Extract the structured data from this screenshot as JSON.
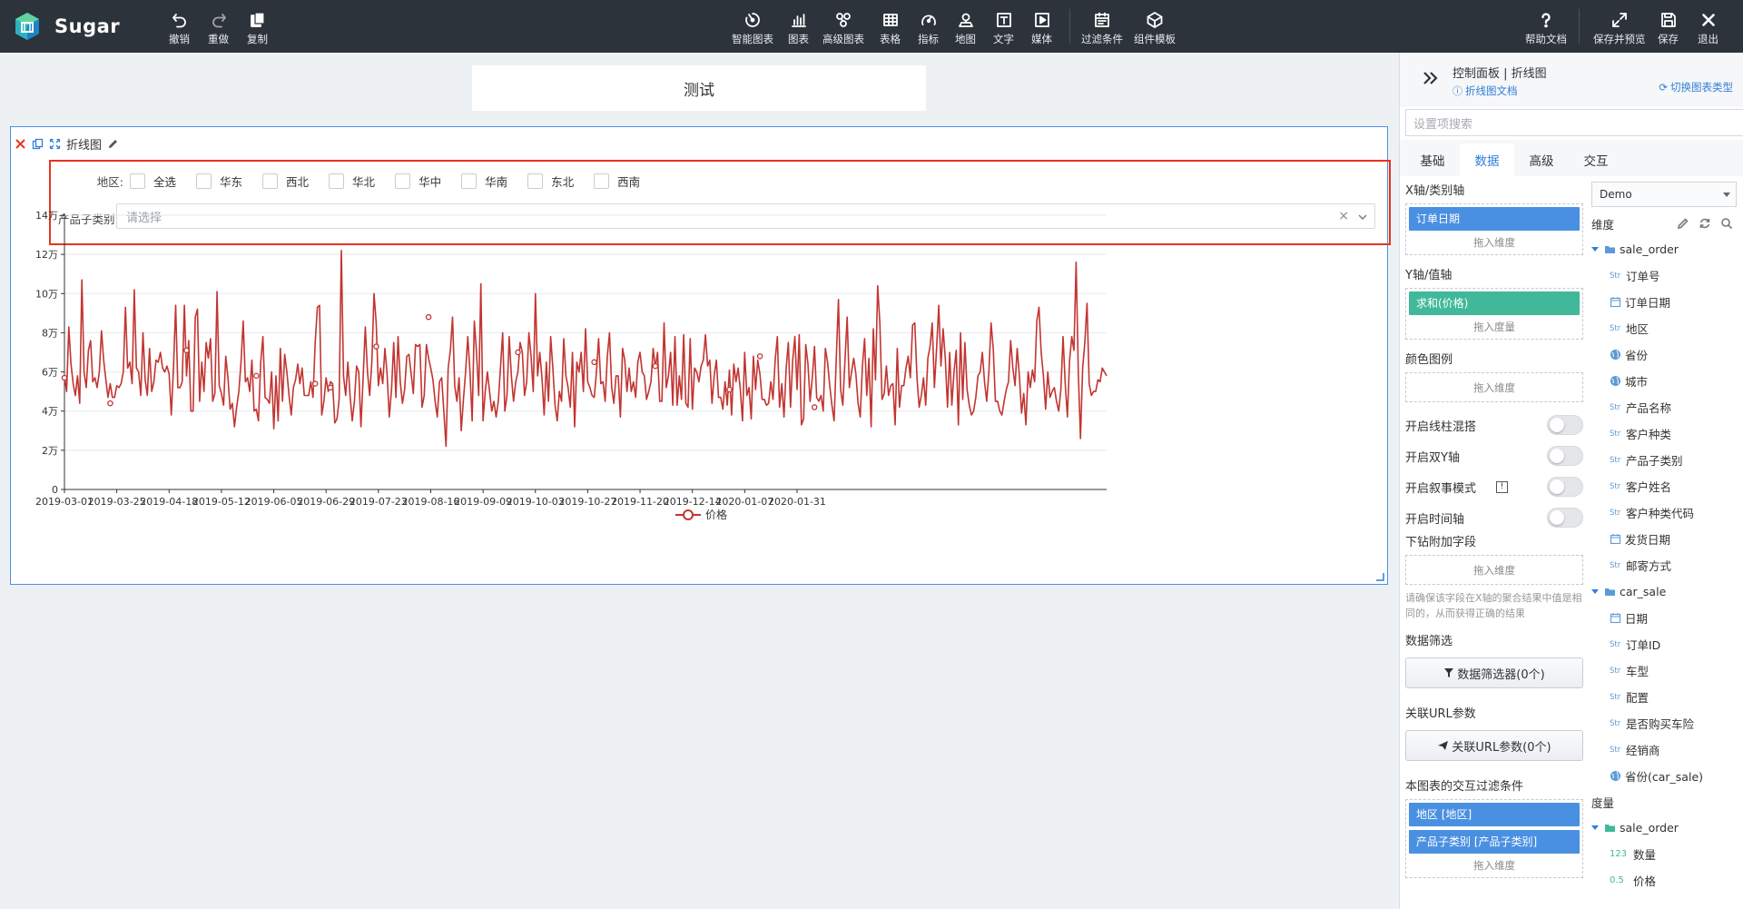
{
  "app": {
    "name": "Sugar"
  },
  "toolbar": {
    "left": [
      {
        "id": "undo",
        "label": "撤销",
        "icon": "undo-icon"
      },
      {
        "id": "redo",
        "label": "重做",
        "icon": "redo-icon"
      },
      {
        "id": "copy",
        "label": "复制",
        "icon": "copy-icon"
      }
    ],
    "center": [
      {
        "id": "smart",
        "label": "智能图表",
        "icon": "smart-chart-icon"
      },
      {
        "id": "chart",
        "label": "图表",
        "icon": "bar-chart-icon"
      },
      {
        "id": "adv",
        "label": "高级图表",
        "icon": "advanced-chart-icon"
      },
      {
        "id": "table",
        "label": "表格",
        "icon": "table-icon"
      },
      {
        "id": "metric",
        "label": "指标",
        "icon": "gauge-icon"
      },
      {
        "id": "map",
        "label": "地图",
        "icon": "map-pin-icon"
      },
      {
        "id": "text",
        "label": "文字",
        "icon": "text-icon"
      },
      {
        "id": "media",
        "label": "媒体",
        "icon": "media-icon"
      },
      {
        "id": "filter",
        "label": "过滤条件",
        "icon": "filter-calendar-icon"
      },
      {
        "id": "template",
        "label": "组件模板",
        "icon": "template-icon"
      }
    ],
    "right": [
      {
        "id": "help",
        "label": "帮助文档",
        "icon": "help-icon"
      },
      {
        "id": "preview",
        "label": "保存并预览",
        "icon": "expand-icon"
      },
      {
        "id": "save",
        "label": "保存",
        "icon": "save-icon"
      },
      {
        "id": "exit",
        "label": "退出",
        "icon": "close-icon"
      }
    ]
  },
  "page": {
    "title": "测试"
  },
  "widget": {
    "title": "折线图",
    "filters": {
      "region_label": "地区:",
      "regions": [
        "全选",
        "华东",
        "西北",
        "华北",
        "华中",
        "华南",
        "东北",
        "西南"
      ],
      "subcat_label": "产品子类别:",
      "subcat_placeholder": "请选择"
    }
  },
  "chart_data": {
    "type": "line",
    "x_start": "2019-03-01",
    "x_tick_labels": [
      "2019-03-01",
      "2019-03-25",
      "2019-04-18",
      "2019-05-12",
      "2019-06-05",
      "2019-06-29",
      "2019-07-23",
      "2019-08-16",
      "2019-09-09",
      "2019-10-03",
      "2019-10-27",
      "2019-11-20",
      "2019-12-14",
      "2020-01-07",
      "2020-01-31"
    ],
    "y_tick_labels": [
      "0",
      "2万",
      "4万",
      "6万",
      "8万",
      "10万",
      "12万",
      "14万"
    ],
    "ylim": [
      0,
      140000
    ],
    "legend": "价格",
    "legend_position": "bottom-center",
    "color": "#c23531",
    "series": [
      {
        "name": "价格",
        "values": [
          58000,
          50000,
          83000,
          64000,
          54000,
          48000,
          58000,
          44000,
          107000,
          60000,
          52000,
          71000,
          76000,
          55000,
          57000,
          52000,
          60000,
          81000,
          66000,
          56000,
          47000,
          54000,
          47000,
          47000,
          53000,
          52000,
          54000,
          60000,
          93000,
          62000,
          65000,
          54000,
          102000,
          62000,
          60000,
          48000,
          80000,
          56000,
          48000,
          72000,
          50000,
          55000,
          66000,
          65000,
          70000,
          62000,
          60000,
          63000,
          59000,
          38000,
          62000,
          94000,
          52000,
          52000,
          55000,
          94000,
          58000,
          76000,
          40000,
          40000,
          88000,
          92000,
          45000,
          65000,
          50000,
          75000,
          67000,
          77000,
          45000,
          49000,
          101000,
          53000,
          49000,
          43000,
          68000,
          57000,
          41000,
          44000,
          32000,
          42000,
          50000,
          65000,
          86000,
          55000,
          57000,
          50000,
          66000,
          40000,
          41000,
          35000,
          65000,
          78000,
          47000,
          46000,
          44000,
          60000,
          31000,
          58000,
          35000,
          72000,
          45000,
          69000,
          60000,
          48000,
          38000,
          52000,
          56000,
          64000,
          54000,
          62000,
          48000,
          48000,
          48000,
          55000,
          47000,
          75000,
          93000,
          94000,
          38000,
          45000,
          57000,
          50000,
          55000,
          54000,
          34000,
          36000,
          46000,
          122000,
          58000,
          48000,
          65000,
          48000,
          35000,
          45000,
          63000,
          60000,
          32000,
          57000,
          83000,
          60000,
          48000,
          65000,
          100000,
          85000,
          53000,
          62000,
          54000,
          72000,
          59000,
          37000,
          51000,
          75000,
          47000,
          78000,
          55000,
          44000,
          51000,
          68000,
          69000,
          59000,
          49000,
          74000,
          73000,
          74000,
          42000,
          48000,
          74000,
          67000,
          62000,
          56000,
          45000,
          37000,
          55000,
          57000,
          40000,
          22000,
          62000,
          71000,
          88000,
          53000,
          45000,
          57000,
          30000,
          46000,
          60000,
          78000,
          60000,
          35000,
          86000,
          70000,
          48000,
          105000,
          35000,
          50000,
          60000,
          50000,
          40000,
          45000,
          37000,
          45000,
          62000,
          80000,
          40000,
          48000,
          78000,
          58000,
          45000,
          55000,
          60000,
          75000,
          70000,
          48000,
          55000,
          80000,
          68000,
          50000,
          100000,
          58000,
          70000,
          57000,
          38000,
          65000,
          45000,
          78000,
          62000,
          43000,
          35000,
          50000,
          45000,
          77000,
          58000,
          52000,
          42000,
          70000,
          32000,
          65000,
          60000,
          70000,
          50000,
          82000,
          55000,
          52000,
          48000,
          47000,
          60000,
          77000,
          54000,
          55000,
          45000,
          68000,
          80000,
          52000,
          44000,
          58000,
          58000,
          37000,
          72000,
          66000,
          50000,
          62000,
          50000,
          55000,
          47000,
          65000,
          70000,
          60000,
          58000,
          46000,
          50000,
          55000,
          72000,
          62000,
          70000,
          45000,
          45000,
          85000,
          52000,
          58000,
          70000,
          43000,
          78000,
          43000,
          58000,
          46000,
          79000,
          44000,
          42000,
          77000,
          41000,
          62000,
          60000,
          55000,
          63000,
          66000,
          79000,
          63000,
          66000,
          44000,
          58000,
          66000,
          47000,
          47000,
          41000,
          55000,
          43000,
          61000,
          38000,
          64000,
          55000,
          62000,
          51000,
          35000,
          70000,
          48000,
          52000,
          36000,
          68000,
          51000,
          66000,
          59000,
          46000,
          46000,
          43000,
          44000,
          55000,
          46000,
          66000,
          78000,
          42000,
          54000,
          37000,
          62000,
          75000,
          42000,
          66000,
          78000,
          51000,
          79000,
          33000,
          36000,
          74000,
          64000,
          45000,
          57000,
          73000,
          47000,
          45000,
          48000,
          40000,
          72000,
          65000,
          53000,
          43000,
          35000,
          67000,
          97000,
          51000,
          43000,
          66000,
          88000,
          52000,
          60000,
          67000,
          59000,
          44000,
          37000,
          63000,
          77000,
          48000,
          67000,
          32000,
          82000,
          56000,
          104000,
          85000,
          46000,
          49000,
          63000,
          48000,
          53000,
          54000,
          33000,
          72000,
          42000,
          53000,
          53000,
          62000,
          68000,
          57000,
          84000,
          85000,
          57000,
          42000,
          48000,
          57000,
          43000,
          67000,
          73000,
          85000,
          52000,
          72000,
          94000,
          63000,
          82000,
          67000,
          42000,
          70000,
          43000,
          60000,
          71000,
          33000,
          80000,
          46000,
          75000,
          51000,
          43000,
          38000,
          40000,
          47000,
          58000,
          60000,
          70000,
          55000,
          45000,
          60000,
          85000,
          72000,
          45000,
          45000,
          40000,
          38000,
          45000,
          51000,
          55000,
          76000,
          62000,
          53000,
          72000,
          58000,
          39000,
          49000,
          33000,
          60000,
          52000,
          61000,
          55000,
          86000,
          93000,
          70000,
          58000,
          41000,
          60000,
          47000,
          50000,
          52000,
          45000,
          40000,
          51000,
          78000,
          54000,
          37000,
          66000,
          78000,
          71000,
          116000,
          60000,
          26000,
          62000,
          75000,
          95000,
          54000,
          48000,
          50000,
          50000,
          56000,
          55000,
          62000,
          60000,
          58000
        ]
      }
    ],
    "markers": [
      {
        "x": "2019-03-01",
        "y": 57000
      },
      {
        "x": "2019-03-22",
        "y": 44000
      },
      {
        "x": "2019-04-26",
        "y": 71000
      },
      {
        "x": "2019-05-28",
        "y": 58000
      },
      {
        "x": "2019-06-24",
        "y": 54000
      },
      {
        "x": "2019-07-01",
        "y": 52000
      },
      {
        "x": "2019-07-22",
        "y": 73000
      },
      {
        "x": "2019-08-15",
        "y": 88000
      },
      {
        "x": "2019-09-25",
        "y": 70000
      },
      {
        "x": "2019-10-30",
        "y": 65000
      },
      {
        "x": "2019-11-27",
        "y": 63000
      },
      {
        "x": "2019-12-31",
        "y": 51000
      },
      {
        "x": "2020-01-14",
        "y": 68000
      },
      {
        "x": "2020-02-08",
        "y": 42000
      }
    ]
  },
  "panel": {
    "title": "控制面板 | 折线图",
    "doc_link": "折线图文档",
    "switch_type": "切换图表类型",
    "search_placeholder": "设置项搜索",
    "tabs": [
      "基础",
      "数据",
      "高级",
      "交互"
    ],
    "active_tab": "数据",
    "x_axis": {
      "title": "X轴/类别轴",
      "pill": "订单日期",
      "drop": "拖入维度"
    },
    "y_axis": {
      "title": "Y轴/值轴",
      "pill": "求和(价格)",
      "drop": "拖入度量"
    },
    "legend": {
      "title": "颜色图例",
      "drop": "拖入维度"
    },
    "toggles": [
      "开启线柱混搭",
      "开启双Y轴",
      "开启叙事模式",
      "开启时间轴"
    ],
    "drill": {
      "title": "下钻附加字段",
      "drop": "拖入维度",
      "note": "请确保该字段在X轴的聚合结果中值是相同的，从而获得正确的结果"
    },
    "data_filter": {
      "title": "数据筛选",
      "button": "数据筛选器(0个)"
    },
    "url_params": {
      "title": "关联URL参数",
      "button": "关联URL参数(0个)"
    },
    "interact_filter": {
      "title": "本图表的交互过滤条件",
      "pills": [
        "地区 [地区]",
        "产品子类别 [产品子类别]"
      ],
      "drop": "拖入维度"
    },
    "datasource": "Demo",
    "dim_title": "维度",
    "groups": [
      {
        "name": "sale_order",
        "items": [
          {
            "label": "订单号",
            "type": "str"
          },
          {
            "label": "订单日期",
            "type": "date"
          },
          {
            "label": "地区",
            "type": "str"
          },
          {
            "label": "省份",
            "type": "geo"
          },
          {
            "label": "城市",
            "type": "geo"
          },
          {
            "label": "产品名称",
            "type": "str"
          },
          {
            "label": "客户种类",
            "type": "str"
          },
          {
            "label": "产品子类别",
            "type": "str"
          },
          {
            "label": "客户姓名",
            "type": "str"
          },
          {
            "label": "客户种类代码",
            "type": "str"
          },
          {
            "label": "发货日期",
            "type": "date"
          },
          {
            "label": "邮寄方式",
            "type": "str"
          }
        ]
      },
      {
        "name": "car_sale",
        "items": [
          {
            "label": "日期",
            "type": "date"
          },
          {
            "label": "订单ID",
            "type": "str"
          },
          {
            "label": "车型",
            "type": "str"
          },
          {
            "label": "配置",
            "type": "str"
          },
          {
            "label": "是否购买车险",
            "type": "str"
          },
          {
            "label": "经销商",
            "type": "str"
          },
          {
            "label": "省份(car_sale)",
            "type": "geo"
          }
        ]
      }
    ],
    "measure_title": "度量",
    "measure_groups": [
      {
        "name": "sale_order",
        "items": [
          {
            "label": "数量",
            "type": "int",
            "badge": "123"
          },
          {
            "label": "价格",
            "type": "float",
            "badge": "0.5"
          }
        ]
      }
    ],
    "badges": {
      "str": "Str"
    }
  }
}
